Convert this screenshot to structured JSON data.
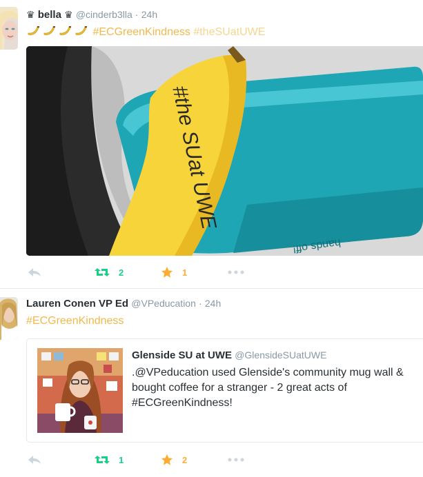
{
  "tweets": [
    {
      "name": "bella",
      "name_prefix_icon": "crown-icon",
      "name_suffix_icon": "crown-icon",
      "handle": "@cinderb3lla",
      "separator": "·",
      "time": "24h",
      "emojis": [
        "banana-emoji",
        "banana-emoji",
        "banana-emoji",
        "banana-emoji"
      ],
      "hashtags": [
        "#ECGreenKindness",
        "#theSUatUWE"
      ],
      "retweet_count": "2",
      "favorite_count": "1"
    },
    {
      "name": "Lauren Conen VP Ed",
      "handle": "@VPeducation",
      "separator": "·",
      "time": "24h",
      "hashtags": [
        "#ECGreenKindness"
      ],
      "quoted": {
        "name": "Glenside SU at UWE",
        "handle": "@GlensideSUatUWE",
        "text_lines": [
          ".@VPeducation used Glenside's community mug wall &",
          "bought coffee for a stranger - 2 great acts of",
          "#ECGreenKindness!"
        ]
      },
      "retweet_count": "1",
      "favorite_count": "2"
    }
  ],
  "photo_writing": "hands off!",
  "banana_writing": "#the SUat UWE",
  "colors": {
    "hashtag": "#f2b84b",
    "retweet_green": "#19cf86",
    "favorite_gold": "#ffac33",
    "meta_gray": "#8899a6",
    "text": "#292f33",
    "divider": "#e1e8ed"
  }
}
